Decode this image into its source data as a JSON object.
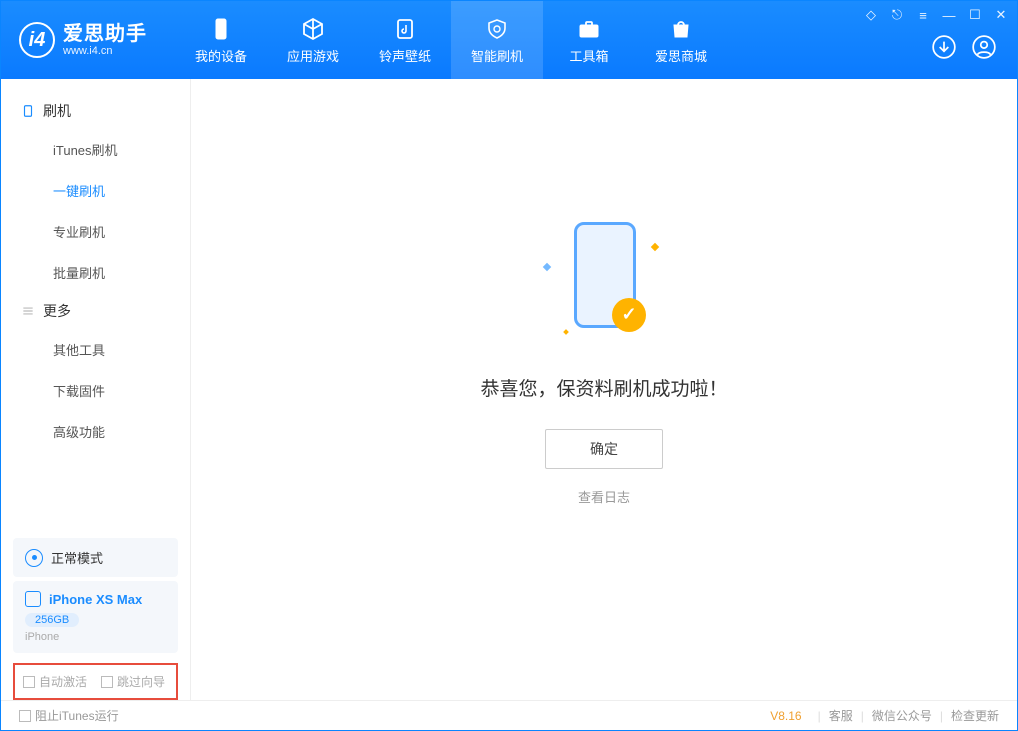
{
  "logo": {
    "title": "爱思助手",
    "subtitle": "www.i4.cn",
    "mark": "i4"
  },
  "nav": [
    {
      "label": "我的设备"
    },
    {
      "label": "应用游戏"
    },
    {
      "label": "铃声壁纸"
    },
    {
      "label": "智能刷机"
    },
    {
      "label": "工具箱"
    },
    {
      "label": "爱思商城"
    }
  ],
  "sidebar": {
    "section1": "刷机",
    "items1": [
      "iTunes刷机",
      "一键刷机",
      "专业刷机",
      "批量刷机"
    ],
    "section2": "更多",
    "items2": [
      "其他工具",
      "下载固件",
      "高级功能"
    ]
  },
  "mode": {
    "label": "正常模式"
  },
  "device": {
    "name": "iPhone XS Max",
    "capacity": "256GB",
    "type": "iPhone"
  },
  "checkboxes": {
    "auto_activate": "自动激活",
    "skip_guide": "跳过向导"
  },
  "main": {
    "message": "恭喜您，保资料刷机成功啦！",
    "ok": "确定",
    "view_log": "查看日志"
  },
  "footer": {
    "block_itunes": "阻止iTunes运行",
    "version": "V8.16",
    "support": "客服",
    "wechat": "微信公众号",
    "update": "检查更新"
  }
}
